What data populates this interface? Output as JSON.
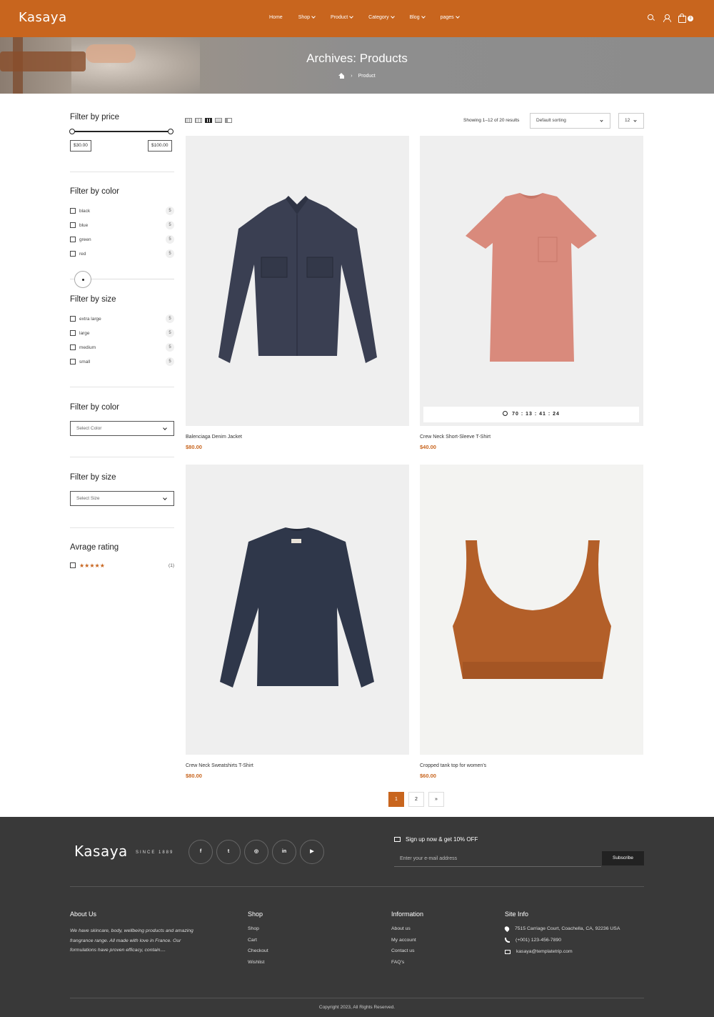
{
  "header": {
    "logo": "Kasaya",
    "nav": [
      {
        "label": "Home",
        "dropdown": false
      },
      {
        "label": "Shop",
        "dropdown": true
      },
      {
        "label": "Product",
        "dropdown": true
      },
      {
        "label": "Category",
        "dropdown": true
      },
      {
        "label": "Blog",
        "dropdown": true
      },
      {
        "label": "pages",
        "dropdown": true
      }
    ],
    "icons": [
      "search-icon",
      "user-icon",
      "cart-icon"
    ],
    "cart_count": "0",
    "accent_color": "#c8651e"
  },
  "banner": {
    "title": "Archives: Products",
    "breadcrumb_current": "Product"
  },
  "sidebar": {
    "price": {
      "title": "Filter by price",
      "min": "$30.00",
      "max": "$100.00"
    },
    "color": {
      "title": "Filter by color",
      "items": [
        {
          "label": "black",
          "count": "5"
        },
        {
          "label": "blue",
          "count": "5"
        },
        {
          "label": "green",
          "count": "5"
        },
        {
          "label": "red",
          "count": "5"
        }
      ]
    },
    "size": {
      "title": "Filter by size",
      "items": [
        {
          "label": "extra large",
          "count": "5"
        },
        {
          "label": "large",
          "count": "5"
        },
        {
          "label": "medium",
          "count": "5"
        },
        {
          "label": "small",
          "count": "5"
        }
      ]
    },
    "color_select": {
      "title": "Filter by color",
      "value": "Select Color"
    },
    "size_select": {
      "title": "Filter by size",
      "value": "Select Size"
    },
    "rating": {
      "title": "Avrage rating",
      "stars": "★★★★★",
      "count": "(1)"
    }
  },
  "toolbar": {
    "results": "Showing 1–12 of 20 results",
    "sort": "Default sorting",
    "per_page": "12"
  },
  "products": [
    {
      "name": "Balenciaga Denim Jacket",
      "price": "$80.00",
      "image": "navy-jacket"
    },
    {
      "name": "Crew Neck Short-Sleeve T-Shirt",
      "price": "$40.00",
      "image": "pink-tshirt",
      "countdown": "70 : 13 : 41 : 24"
    },
    {
      "name": "Crew Neck Sweatshirts T-Shirt",
      "price": "$80.00",
      "image": "navy-sweatshirt"
    },
    {
      "name": "Cropped tank top for women's",
      "price": "$60.00",
      "image": "brown-tank-top"
    }
  ],
  "pagination": {
    "pages": [
      "1",
      "2"
    ],
    "current": "1",
    "next": "»"
  },
  "footer": {
    "logo": "Kasaya",
    "since": "SINCE 1889",
    "socials": [
      "facebook-icon",
      "twitter-icon",
      "instagram-icon",
      "linkedin-icon",
      "youtube-icon"
    ],
    "signup_text": "Sign up now & get 10% OFF",
    "email_placeholder": "Enter your e-mail address",
    "subscribe": "Subscribe",
    "about": {
      "title": "About Us",
      "text": "We have skincare, body, wellbeing products and amazing frangrance range. All made with love in France. Our formulations have proven efficacy, contain...."
    },
    "shop": {
      "title": "Shop",
      "links": [
        "Shop",
        "Cart",
        "Checkout",
        "Wishlist"
      ]
    },
    "information": {
      "title": "Information",
      "links": [
        "About us",
        "My account",
        "Contact us",
        "FAQ's"
      ]
    },
    "site_info": {
      "title": "Site Info",
      "address": "7515 Carriage Court, Coachella, CA, 92236 USA",
      "phone": "(+001) 123-456-7890",
      "email": "kasaya@templatetrip.com"
    },
    "copyright": "Copyright 2023, All Rights Reserved."
  }
}
